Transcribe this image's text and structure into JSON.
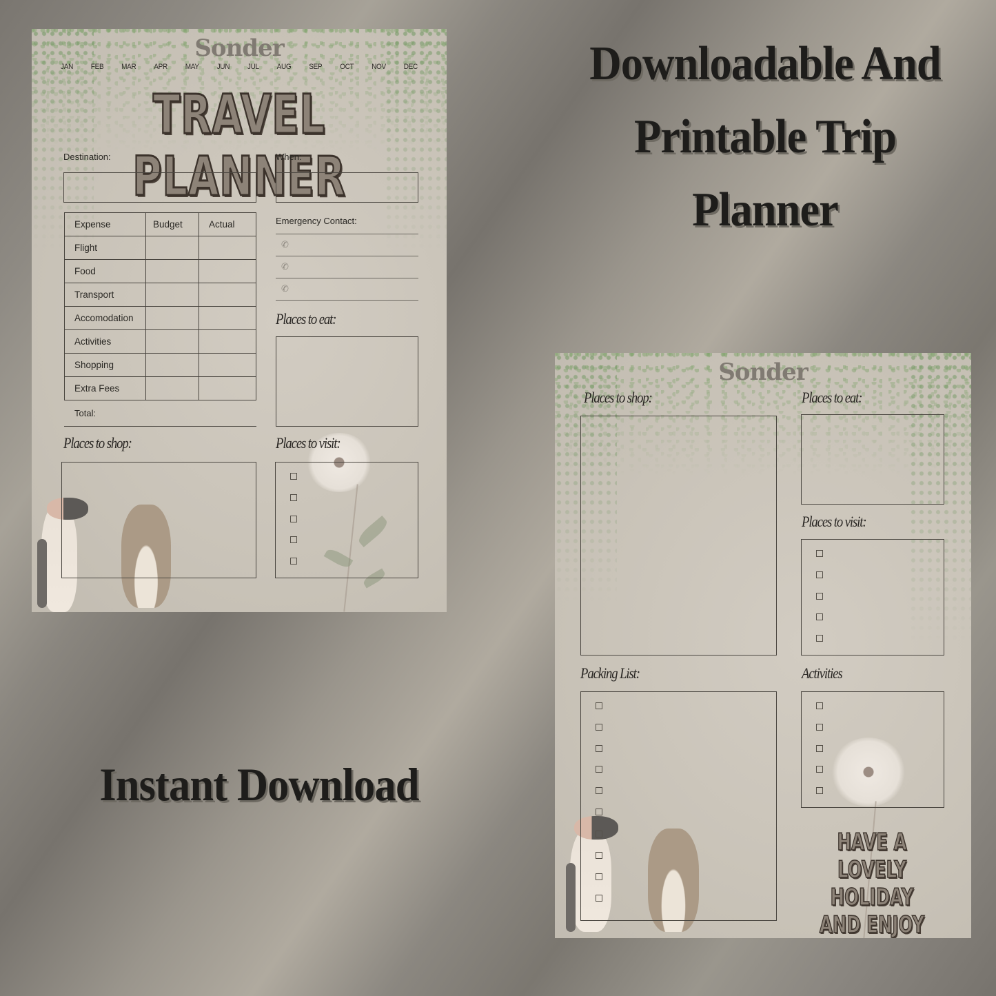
{
  "headline": {
    "line1": "Downloadable And",
    "line2": "Printable Trip",
    "line3": "Planner",
    "instant": "Instant Download"
  },
  "page1": {
    "brand": "Sonder",
    "months": [
      "JAN",
      "FEB",
      "MAR",
      "APR",
      "MAY",
      "JUN",
      "JUL",
      "AUG",
      "SEP",
      "OCT",
      "NOV",
      "DEC"
    ],
    "title": "TRAVEL PLANNER",
    "destination_label": "Destination:",
    "when_label": "When:",
    "expense_table": {
      "headers": [
        "Expense",
        "Budget",
        "Actual"
      ],
      "rows": [
        "Flight",
        "Food",
        "Transport",
        "Accomodation",
        "Activities",
        "Shopping",
        "Extra Fees"
      ],
      "total_label": "Total:"
    },
    "emergency_label": "Emergency Contact:",
    "phone_icon": "phone-icon",
    "places_to_eat": "Places to eat:",
    "places_to_shop": "Places to shop:",
    "places_to_visit": "Places to visit:",
    "visit_checkbox_count": 5
  },
  "page2": {
    "brand": "Sonder",
    "places_to_shop": "Places to shop:",
    "places_to_eat": "Places to eat:",
    "places_to_visit": "Places to visit:",
    "packing_list": "Packing List:",
    "activities": "Activities",
    "visit_checkbox_count": 5,
    "packing_checkbox_count": 10,
    "activities_checkbox_count": 5,
    "greeting": [
      "HAVE A",
      "LOVELY HOLIDAY",
      "AND ENJOY IT!"
    ]
  },
  "colors": {
    "page_bg": "#cbc5ba",
    "ivy": "#7ea06a",
    "title_fill": "#8d8378",
    "title_outline": "#3b322b",
    "headline_text": "#1e1d1b"
  }
}
